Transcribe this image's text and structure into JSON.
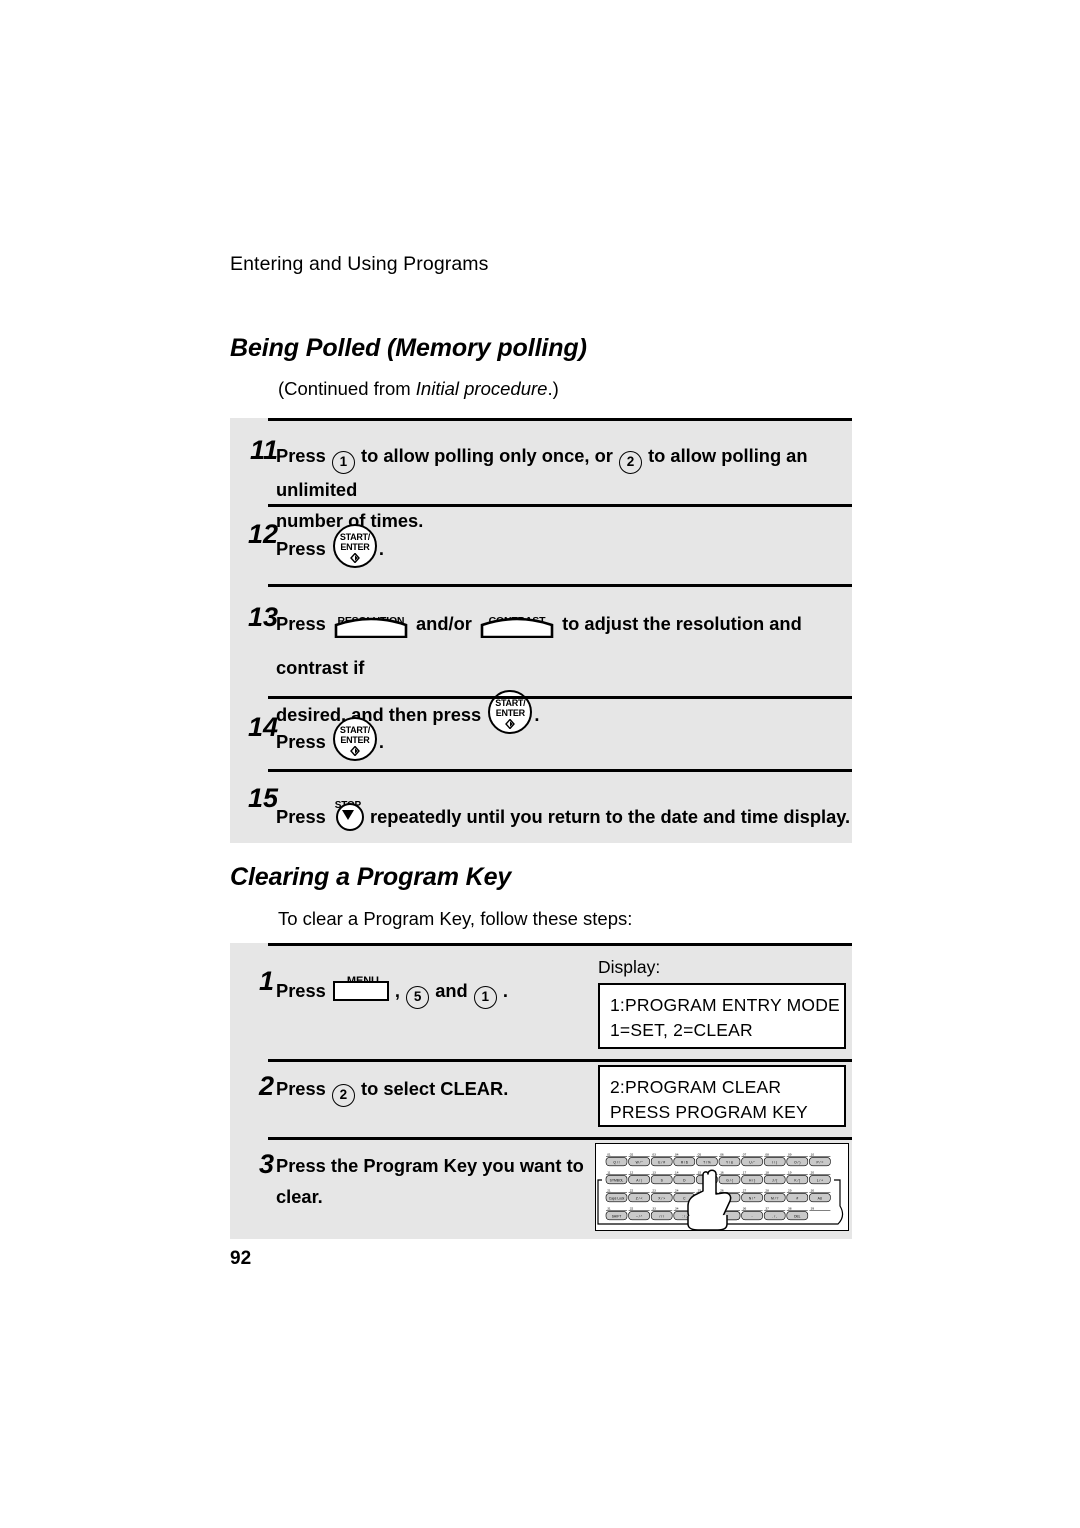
{
  "page": {
    "running_head": "Entering and Using Programs",
    "page_number": "92"
  },
  "sections": [
    {
      "id": "being-polled",
      "heading": "Being Polled (Memory polling)",
      "intro_prefix": "(Continued from ",
      "intro_italic": "Initial procedure",
      "intro_suffix": ".)"
    },
    {
      "id": "clearing-program-key",
      "heading": "Clearing a Program Key",
      "intro": "To clear a Program Key, follow these steps:"
    }
  ],
  "panel_a": {
    "steps": [
      {
        "num": "11",
        "line1_a": "Press",
        "key1": "1",
        "line1_b": "to allow polling only once, or",
        "key2": "2",
        "line1_c": "to allow polling an unlimited",
        "line2": "number of times."
      },
      {
        "num": "12",
        "text_before": "Press",
        "button": {
          "line1": "START/",
          "line2": "ENTER"
        },
        "text_after": "."
      },
      {
        "num": "13",
        "t1": "Press",
        "btn1_label": "RESOLUTION",
        "t2": "and/or",
        "btn2_label": "CONTRAST",
        "t3": "to adjust the resolution and contrast if",
        "t4": "desired, and then press",
        "btn3": {
          "line1": "START/",
          "line2": "ENTER"
        },
        "t5": "."
      },
      {
        "num": "14",
        "text_before": "Press",
        "button": {
          "line1": "START/",
          "line2": "ENTER"
        },
        "text_after": "."
      },
      {
        "num": "15",
        "text_before": "Press",
        "button_label": "STOP",
        "text_after": "repeatedly until you return to the date and time display."
      }
    ]
  },
  "panel_b": {
    "display_label": "Display:",
    "steps": [
      {
        "num": "1",
        "t1": "Press",
        "menu_label": "MENU",
        "t2": ",",
        "key1": "5",
        "t3": "and",
        "key2": "1",
        "t4": ".",
        "lcd": [
          "1:PROGRAM ENTRY MODE",
          "1=SET, 2=CLEAR"
        ]
      },
      {
        "num": "2",
        "t1": "Press",
        "key1": "2",
        "t2": "to select CLEAR.",
        "lcd": [
          "2:PROGRAM CLEAR",
          "PRESS PROGRAM KEY"
        ]
      },
      {
        "num": "3",
        "line1": "Press the Program Key you want to",
        "line2": "clear."
      }
    ]
  },
  "keyboard_figure": {
    "rows": [
      {
        "numbers": [
          "01",
          "02",
          "03",
          "04",
          "05",
          "06",
          "07",
          "08",
          "09",
          "10"
        ],
        "keys": [
          "Q / !",
          "W / \"",
          "E / #",
          "R / $",
          "T / %",
          "Y / &",
          "U / '",
          "I / (",
          "O / )",
          "P / ="
        ]
      },
      {
        "numbers": [
          "11",
          "12",
          "13",
          "14",
          "15",
          "16",
          "17",
          "18",
          "19",
          "20"
        ],
        "keys": [
          "SYMBOL",
          "A / |",
          "S",
          "D",
          "F",
          "G / {",
          "H / }",
          "J / [",
          "K / ]",
          "L / +"
        ]
      },
      {
        "numbers": [
          "21",
          "22",
          "23",
          "24",
          "25",
          "26",
          "27",
          "28",
          "29",
          "30"
        ],
        "keys": [
          "Caps Lock",
          "Z / <",
          "X / >",
          "C",
          "V",
          "B",
          "N / *",
          "M / ?",
          "#",
          "AU"
        ]
      },
      {
        "numbers": [
          "31",
          "32",
          "33",
          "34",
          "",
          "",
          "36",
          "37",
          "38",
          "39"
        ],
        "keys": [
          "SHIFT",
          "~ / ^",
          "/ / \\",
          ": / ;",
          "",
          "_",
          "-",
          ". / ,",
          "DEL"
        ]
      }
    ]
  },
  "colors": {
    "panel_bg": "#e6e6e6",
    "rule": "#000000",
    "key_fill": "#c9c9c9",
    "hand_fill": "#ffffff",
    "page_bg": "#ffffff"
  }
}
